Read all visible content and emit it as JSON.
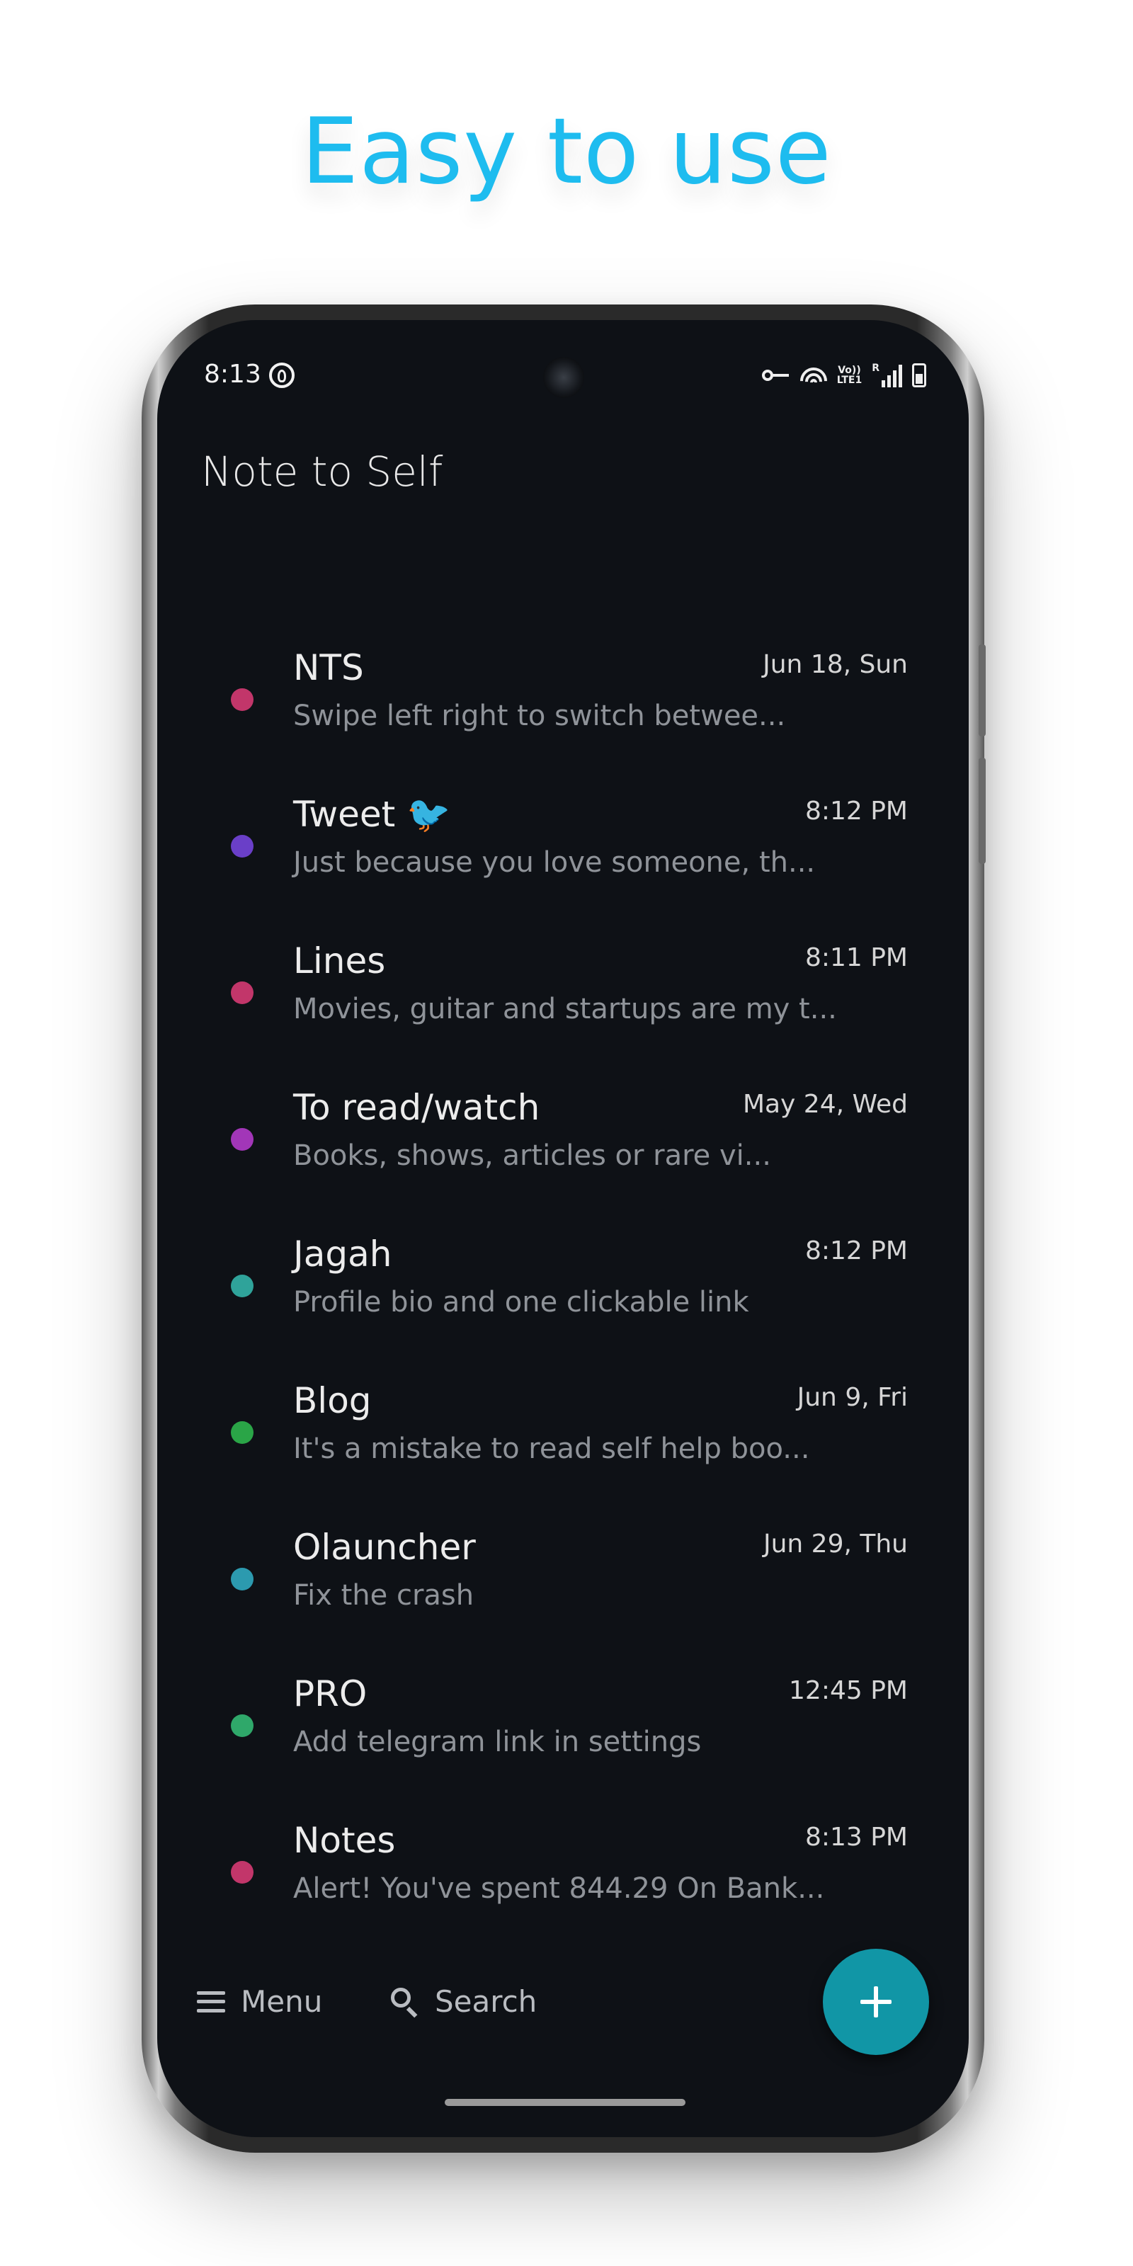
{
  "headline": "Easy to use",
  "status_bar": {
    "time": "8:13",
    "volte_top": "Vo))",
    "volte_bottom": "LTE1",
    "roaming": "R",
    "icons": [
      "app-logo-icon",
      "vpn-key-icon",
      "wifi-icon",
      "volte-icon",
      "signal-icon",
      "battery-icon"
    ]
  },
  "app": {
    "title": "Note to Self"
  },
  "notes": [
    {
      "title": "NTS",
      "preview": "Swipe left right to switch betwee...",
      "date": "Jun 18, Sun",
      "color": "#C2366A"
    },
    {
      "title": "Tweet 🐦",
      "preview": "Just because you love someone, th...",
      "date": "8:12 PM",
      "color": "#6A3FC8"
    },
    {
      "title": "Lines",
      "preview": "Movies, guitar and startups are my t...",
      "date": "8:11 PM",
      "color": "#C2366A"
    },
    {
      "title": "To read/watch",
      "preview": "Books, shows, articles or rare vi...",
      "date": "May 24, Wed",
      "color": "#A236B8"
    },
    {
      "title": "Jagah",
      "preview": "Profile bio and one clickable link",
      "date": "8:12 PM",
      "color": "#2FA39A"
    },
    {
      "title": "Blog",
      "preview": "It's a mistake to read self help boo...",
      "date": "Jun 9, Fri",
      "color": "#2AA547"
    },
    {
      "title": "Olauncher",
      "preview": "Fix the crash",
      "date": "Jun 29, Thu",
      "color": "#2C9AAF"
    },
    {
      "title": "PRO",
      "preview": "Add telegram link in settings",
      "date": "12:45 PM",
      "color": "#2FA86A"
    },
    {
      "title": "Notes",
      "preview": "Alert! You've spent 844.29 On Bank...",
      "date": "8:13 PM",
      "color": "#C2366A"
    }
  ],
  "bottom_bar": {
    "menu_label": "Menu",
    "search_label": "Search",
    "fab_icon": "plus-icon"
  },
  "colors": {
    "headline": "#1EBCEF",
    "screen_bg": "#0E1116",
    "fab": "#1196A6"
  }
}
